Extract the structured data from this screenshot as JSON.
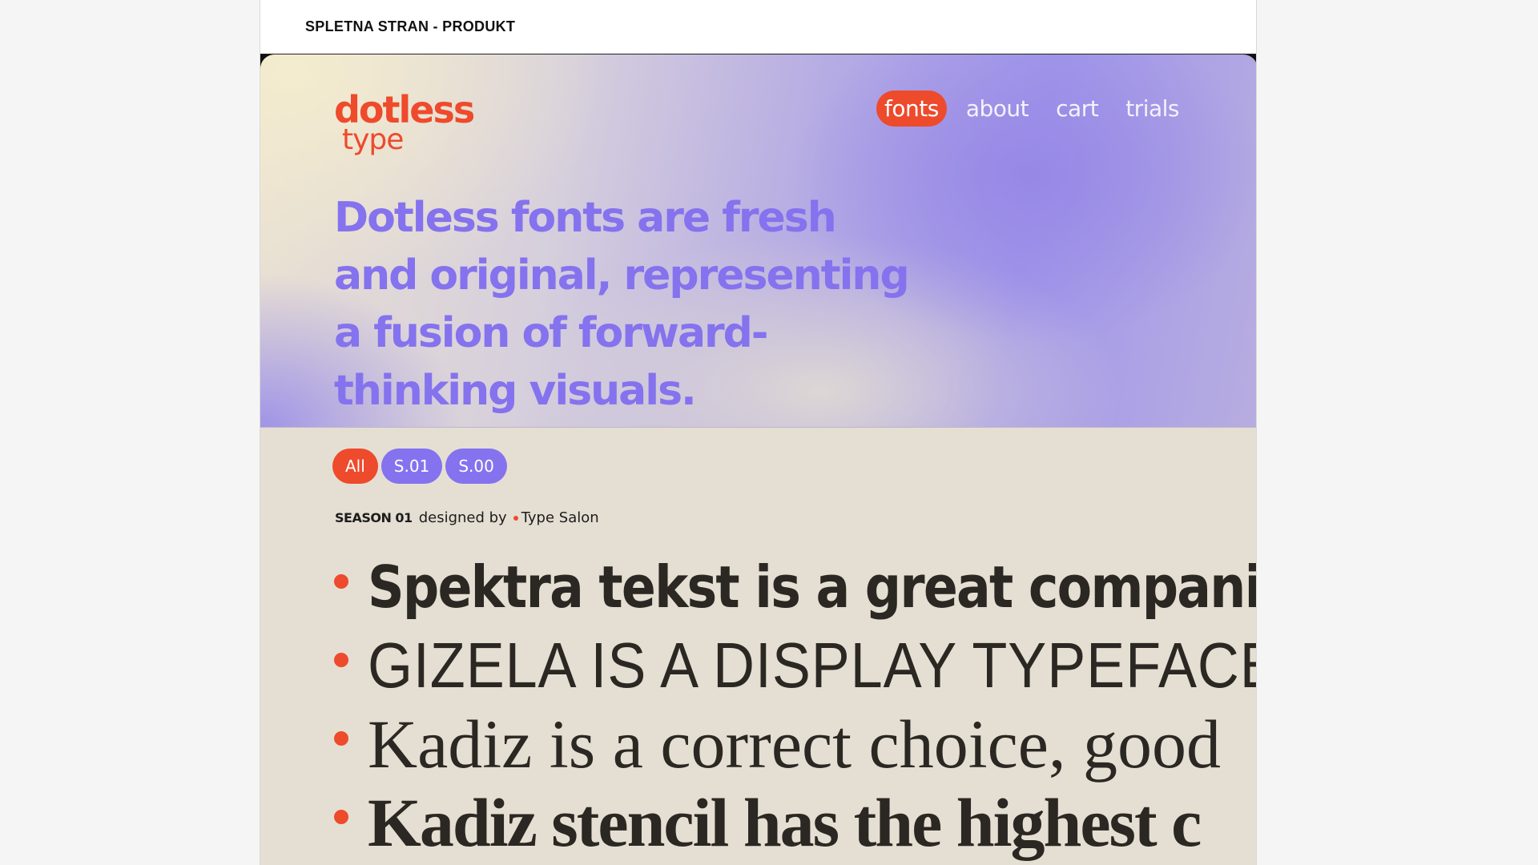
{
  "frame": {
    "title": "SPLETNA STRAN - PRODUKT"
  },
  "brand": {
    "logo_line1": "dotless",
    "logo_line2": "type",
    "accent_color": "#ee4a2c",
    "purple_color": "#8572ee"
  },
  "nav": {
    "items": [
      {
        "label": "fonts",
        "active": true
      },
      {
        "label": "about",
        "active": false
      },
      {
        "label": "cart",
        "active": false
      },
      {
        "label": "trials",
        "active": false
      }
    ]
  },
  "hero": {
    "tagline": "Dotless fonts are fresh and original, representing a fusion of forward-thinking visuals."
  },
  "filters": {
    "items": [
      {
        "label": "All",
        "active": true
      },
      {
        "label": "S.01",
        "active": false
      },
      {
        "label": "S.00",
        "active": false
      }
    ]
  },
  "season": {
    "tag": "SEASON 01",
    "designed_by_label": "designed by",
    "designer": "Type Salon"
  },
  "fonts": [
    {
      "name": "Spektra tekst",
      "sample": "Spektra tekst is a great companio"
    },
    {
      "name": "Gizela",
      "sample": "GIZELA IS A DISPLAY TYPEFACE PER"
    },
    {
      "name": "Kadiz",
      "sample": "Kadiz is a correct choice, good"
    },
    {
      "name": "Kadiz stencil",
      "sample": "Kadiz stencil has the highest c"
    }
  ]
}
